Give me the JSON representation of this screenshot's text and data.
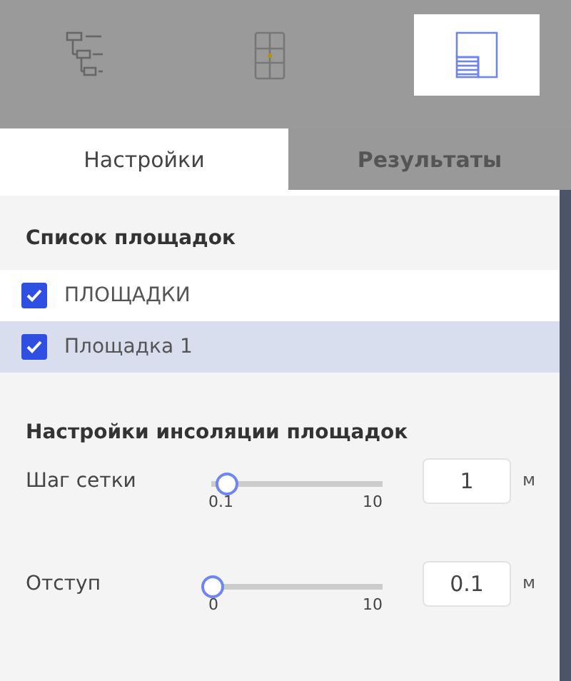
{
  "toolbar": [
    {
      "kind": "tree",
      "selected": false
    },
    {
      "kind": "grid",
      "selected": false
    },
    {
      "kind": "layout",
      "selected": true
    }
  ],
  "tabs": [
    {
      "label": "Настройки",
      "selected": true
    },
    {
      "label": "Результаты",
      "selected": false
    }
  ],
  "sites": {
    "title": "Список площадок",
    "items": [
      {
        "label": "ПЛОЩАДКИ",
        "checked": true,
        "selected": false
      },
      {
        "label": "Площадка 1",
        "checked": true,
        "selected": true
      }
    ]
  },
  "insolation": {
    "title": "Настройки инсоляции площадок",
    "params": [
      {
        "label": "Шаг сетки",
        "level": 0.09,
        "min": "0.1",
        "max": "10",
        "value": "1",
        "unit": "м"
      },
      {
        "label": "Отступ",
        "level": 0.01,
        "min": "0",
        "max": "10",
        "value": "0.1",
        "unit": "м"
      }
    ]
  }
}
